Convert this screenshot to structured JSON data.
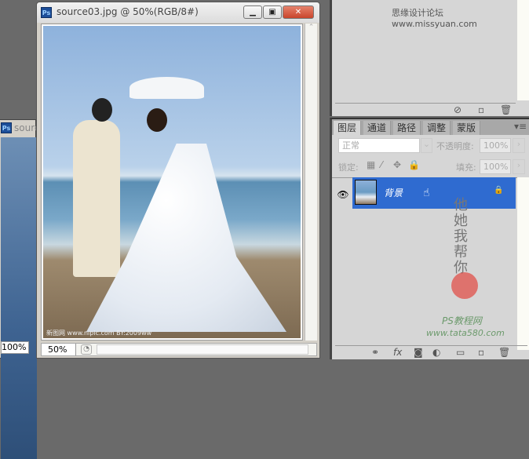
{
  "back_window": {
    "title": "source",
    "zoom": "100%"
  },
  "main_window": {
    "title": "source03.jpg @ 50%(RGB/8#)",
    "zoom": "50%",
    "image_watermark": "新图网 www.nipic.com BY:2009ww"
  },
  "top_panel": {
    "watermark": "思缘设计论坛 www.missyuan.com"
  },
  "layers_panel": {
    "tabs": [
      "图层",
      "通道",
      "路径",
      "调整",
      "蒙版"
    ],
    "blend_mode": "正常",
    "opacity_label": "不透明度:",
    "opacity": "100%",
    "lock_label": "锁定:",
    "fill_label": "填充:",
    "fill": "100%",
    "layers": [
      {
        "name": "背景",
        "visible": true,
        "locked": true,
        "selected": true
      }
    ],
    "watermark_lines": [
      "他她我帮你",
      "PS教程网",
      "www.tata580.com"
    ]
  },
  "colors": {
    "selected_layer": "#2f6bd0",
    "background": "#6a6a6a",
    "panel": "#d6d6d6"
  }
}
